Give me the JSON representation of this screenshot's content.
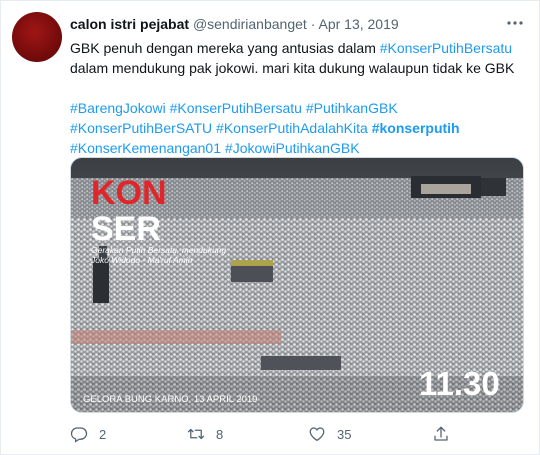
{
  "tweet": {
    "author_name": "calon istri pejabat",
    "handle": "@sendirianbanget",
    "separator": "·",
    "date": "Apr 13, 2019",
    "text_part1": "GBK penuh dengan mereka yang antusias dalam",
    "text_tag1": "#KonserPutihBersatu",
    "text_part2": "dalam mendukung pak jokowi. mari kita dukung walaupun tidak ke GBK",
    "hashtags_line1": [
      "#BarengJokowi",
      "#KonserPutihBersatu",
      "#PutihkanGBK"
    ],
    "hashtags_line2": [
      "#KonserPutihBerSATU",
      "#KonserPutihAdalahKita",
      "#konserputih"
    ],
    "hashtags_line3": [
      "#KonserKemenangan01",
      "#JokowiPutihkanGBK"
    ]
  },
  "media": {
    "title_top": "KON",
    "title_bottom": "SER",
    "subtitle_line1": "Gerakan Putih Bersatu, mendukung",
    "subtitle_line2": "Joko Widodo - Ma'ruf Amin",
    "time": "11.30",
    "location_date": "GELORA BUNG KARNO, 13 APRIL 2019",
    "accent_red": "#e0262b"
  },
  "actions": {
    "reply_count": "2",
    "retweet_count": "8",
    "like_count": "35",
    "icons": [
      "reply-icon",
      "retweet-icon",
      "like-icon",
      "share-icon"
    ]
  },
  "colors": {
    "link": "#1d9bf0",
    "muted": "#536471",
    "text": "#0f1419"
  }
}
